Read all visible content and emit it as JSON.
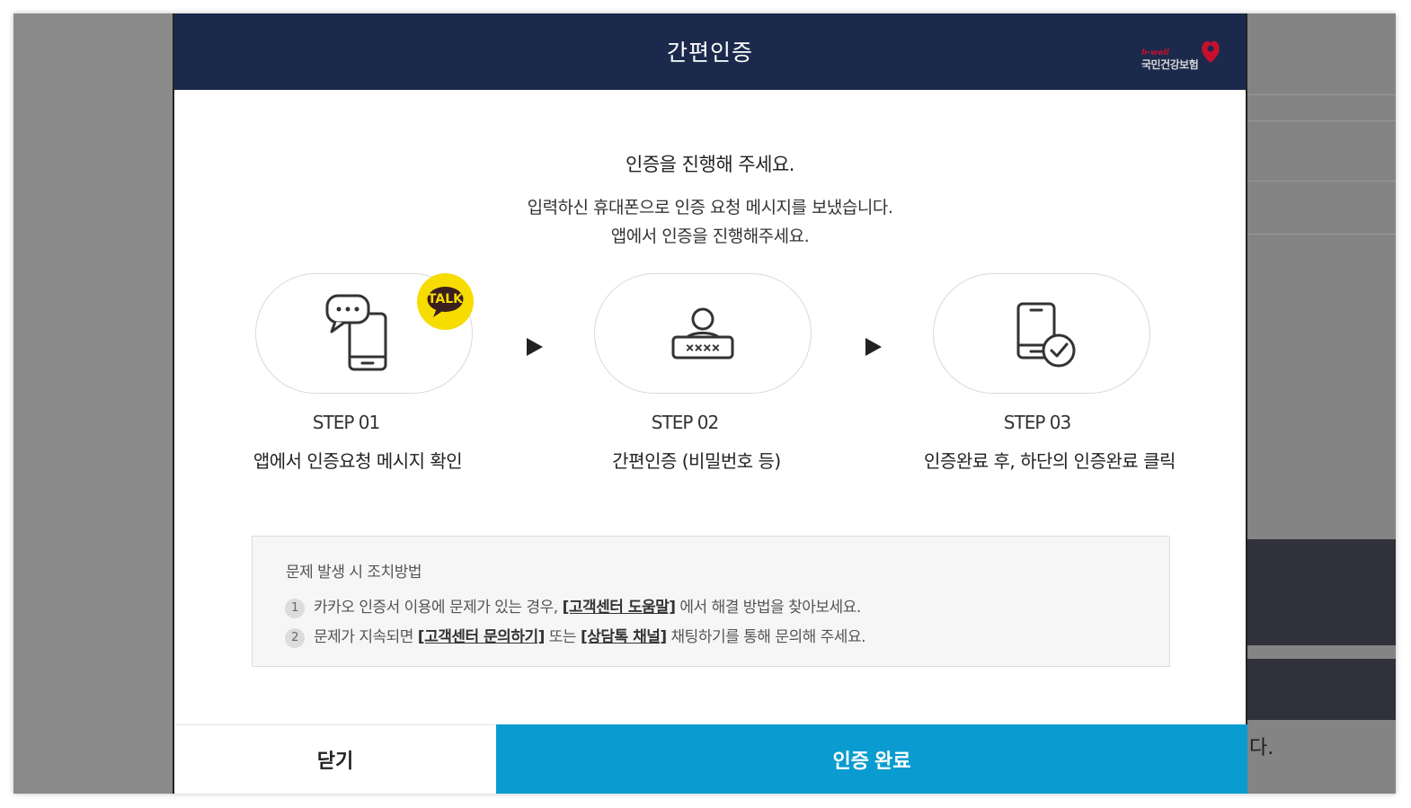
{
  "background": {
    "partial_text": "다."
  },
  "modal": {
    "title": "간편인증",
    "logo": {
      "tagline": "h-well",
      "name": "국민건강보험"
    },
    "heading": "인증을 진행해 주세요.",
    "description_line1": "입력하신 휴대폰으로 인증 요청 메시지를 보냈습니다.",
    "description_line2": "앱에서 인증을 진행해주세요.",
    "talk_badge": "TALK",
    "steps": [
      {
        "label": "STEP 01",
        "description": "앱에서 인증요청 메시지 확인",
        "icon": "chat-phone-icon"
      },
      {
        "label": "STEP 02",
        "description": "간편인증 (비밀번호 등)",
        "icon": "user-password-icon"
      },
      {
        "label": "STEP 03",
        "description": "인증완료 후, 하단의 인증완료 클릭",
        "icon": "phone-check-icon"
      }
    ],
    "help": {
      "title": "문제 발생 시 조치방법",
      "items": [
        {
          "num": "1",
          "text_before": "카카오 인증서 이용에 문제가 있는 경우,",
          "link1": "[고객센터 도움말]",
          "text_after": "에서 해결 방법을 찾아보세요."
        },
        {
          "num": "2",
          "text_before": "문제가 지속되면",
          "link1": "[고객센터 문의하기]",
          "text_middle": "또는",
          "link2": "[상담톡 채널]",
          "text_after": "채팅하기를 통해 문의해 주세요."
        }
      ]
    },
    "buttons": {
      "close": "닫기",
      "confirm": "인증 완료"
    }
  },
  "colors": {
    "header": "#1b2a4c",
    "confirm_button": "#0a9cd0",
    "talk_badge": "#f7dc00",
    "logo_red": "#c8102e"
  }
}
